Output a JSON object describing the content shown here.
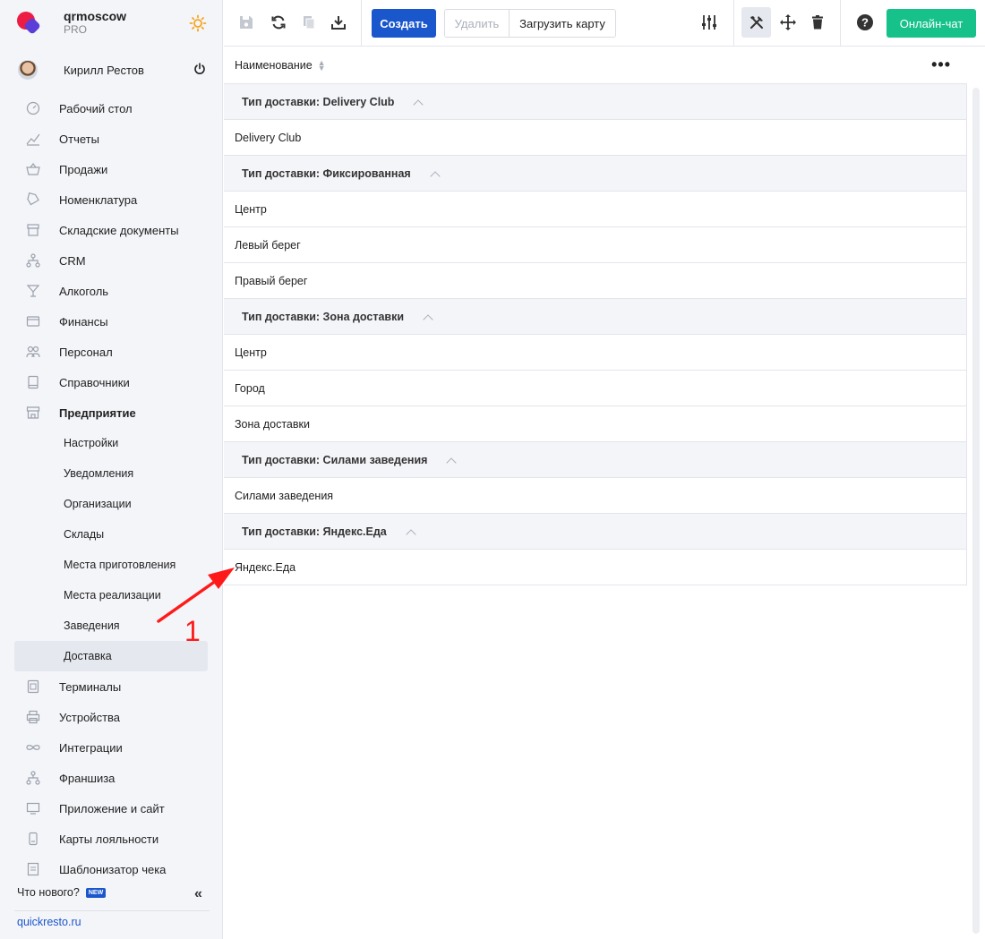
{
  "brand": {
    "name": "qrmoscow",
    "plan": "PRO"
  },
  "user": {
    "name": "Кирилл Рестов"
  },
  "sidebar": {
    "items": [
      {
        "label": "Рабочий стол",
        "icon": "dashboard-icon"
      },
      {
        "label": "Отчеты",
        "icon": "chart-icon"
      },
      {
        "label": "Продажи",
        "icon": "basket-icon"
      },
      {
        "label": "Номенклатура",
        "icon": "tag-icon"
      },
      {
        "label": "Складские документы",
        "icon": "box-icon"
      },
      {
        "label": "CRM",
        "icon": "hierarchy-icon"
      },
      {
        "label": "Алкоголь",
        "icon": "cocktail-icon"
      },
      {
        "label": "Финансы",
        "icon": "wallet-icon"
      },
      {
        "label": "Персонал",
        "icon": "people-icon"
      },
      {
        "label": "Справочники",
        "icon": "book-icon"
      },
      {
        "label": "Предприятие",
        "icon": "store-icon"
      }
    ],
    "sub_items": [
      {
        "label": "Настройки"
      },
      {
        "label": "Уведомления"
      },
      {
        "label": "Организации"
      },
      {
        "label": "Склады"
      },
      {
        "label": "Места приготовления"
      },
      {
        "label": "Места реализации"
      },
      {
        "label": "Заведения"
      },
      {
        "label": "Доставка"
      }
    ],
    "items_after": [
      {
        "label": "Терминалы",
        "icon": "qr-icon"
      },
      {
        "label": "Устройства",
        "icon": "printer-icon"
      },
      {
        "label": "Интеграции",
        "icon": "infinity-icon"
      },
      {
        "label": "Франшиза",
        "icon": "hierarchy-icon"
      },
      {
        "label": "Приложение и сайт",
        "icon": "monitor-icon"
      },
      {
        "label": "Карты лояльности",
        "icon": "card-icon"
      },
      {
        "label": "Шаблонизатор чека",
        "icon": "receipt-icon"
      }
    ],
    "whats_new": "Что нового?",
    "new_badge": "NEW",
    "site_link": "quickresto.ru"
  },
  "toolbar": {
    "create_label": "Создать",
    "delete_label": "Удалить",
    "upload_label": "Загрузить карту",
    "chat_label": "Онлайн-чат"
  },
  "table": {
    "column_header": "Наименование",
    "groups": [
      {
        "label": "Тип доставки: Delivery Club",
        "rows": [
          "Delivery Club"
        ]
      },
      {
        "label": "Тип доставки: Фиксированная",
        "rows": [
          "Центр",
          "Левый берег",
          "Правый берег"
        ]
      },
      {
        "label": "Тип доставки: Зона доставки",
        "rows": [
          "Центр",
          "Город",
          "Зона доставки"
        ]
      },
      {
        "label": "Тип доставки: Силами заведения",
        "rows": [
          "Силами заведения"
        ]
      },
      {
        "label": "Тип доставки: Яндекс.Еда",
        "rows": [
          "Яндекс.Еда"
        ]
      }
    ]
  },
  "annotation": {
    "number": "1"
  },
  "colors": {
    "primary": "#1a56cc",
    "chat": "#16c28a",
    "annotation": "#ff1a1a",
    "sidebar_bg": "#f4f5f9"
  }
}
